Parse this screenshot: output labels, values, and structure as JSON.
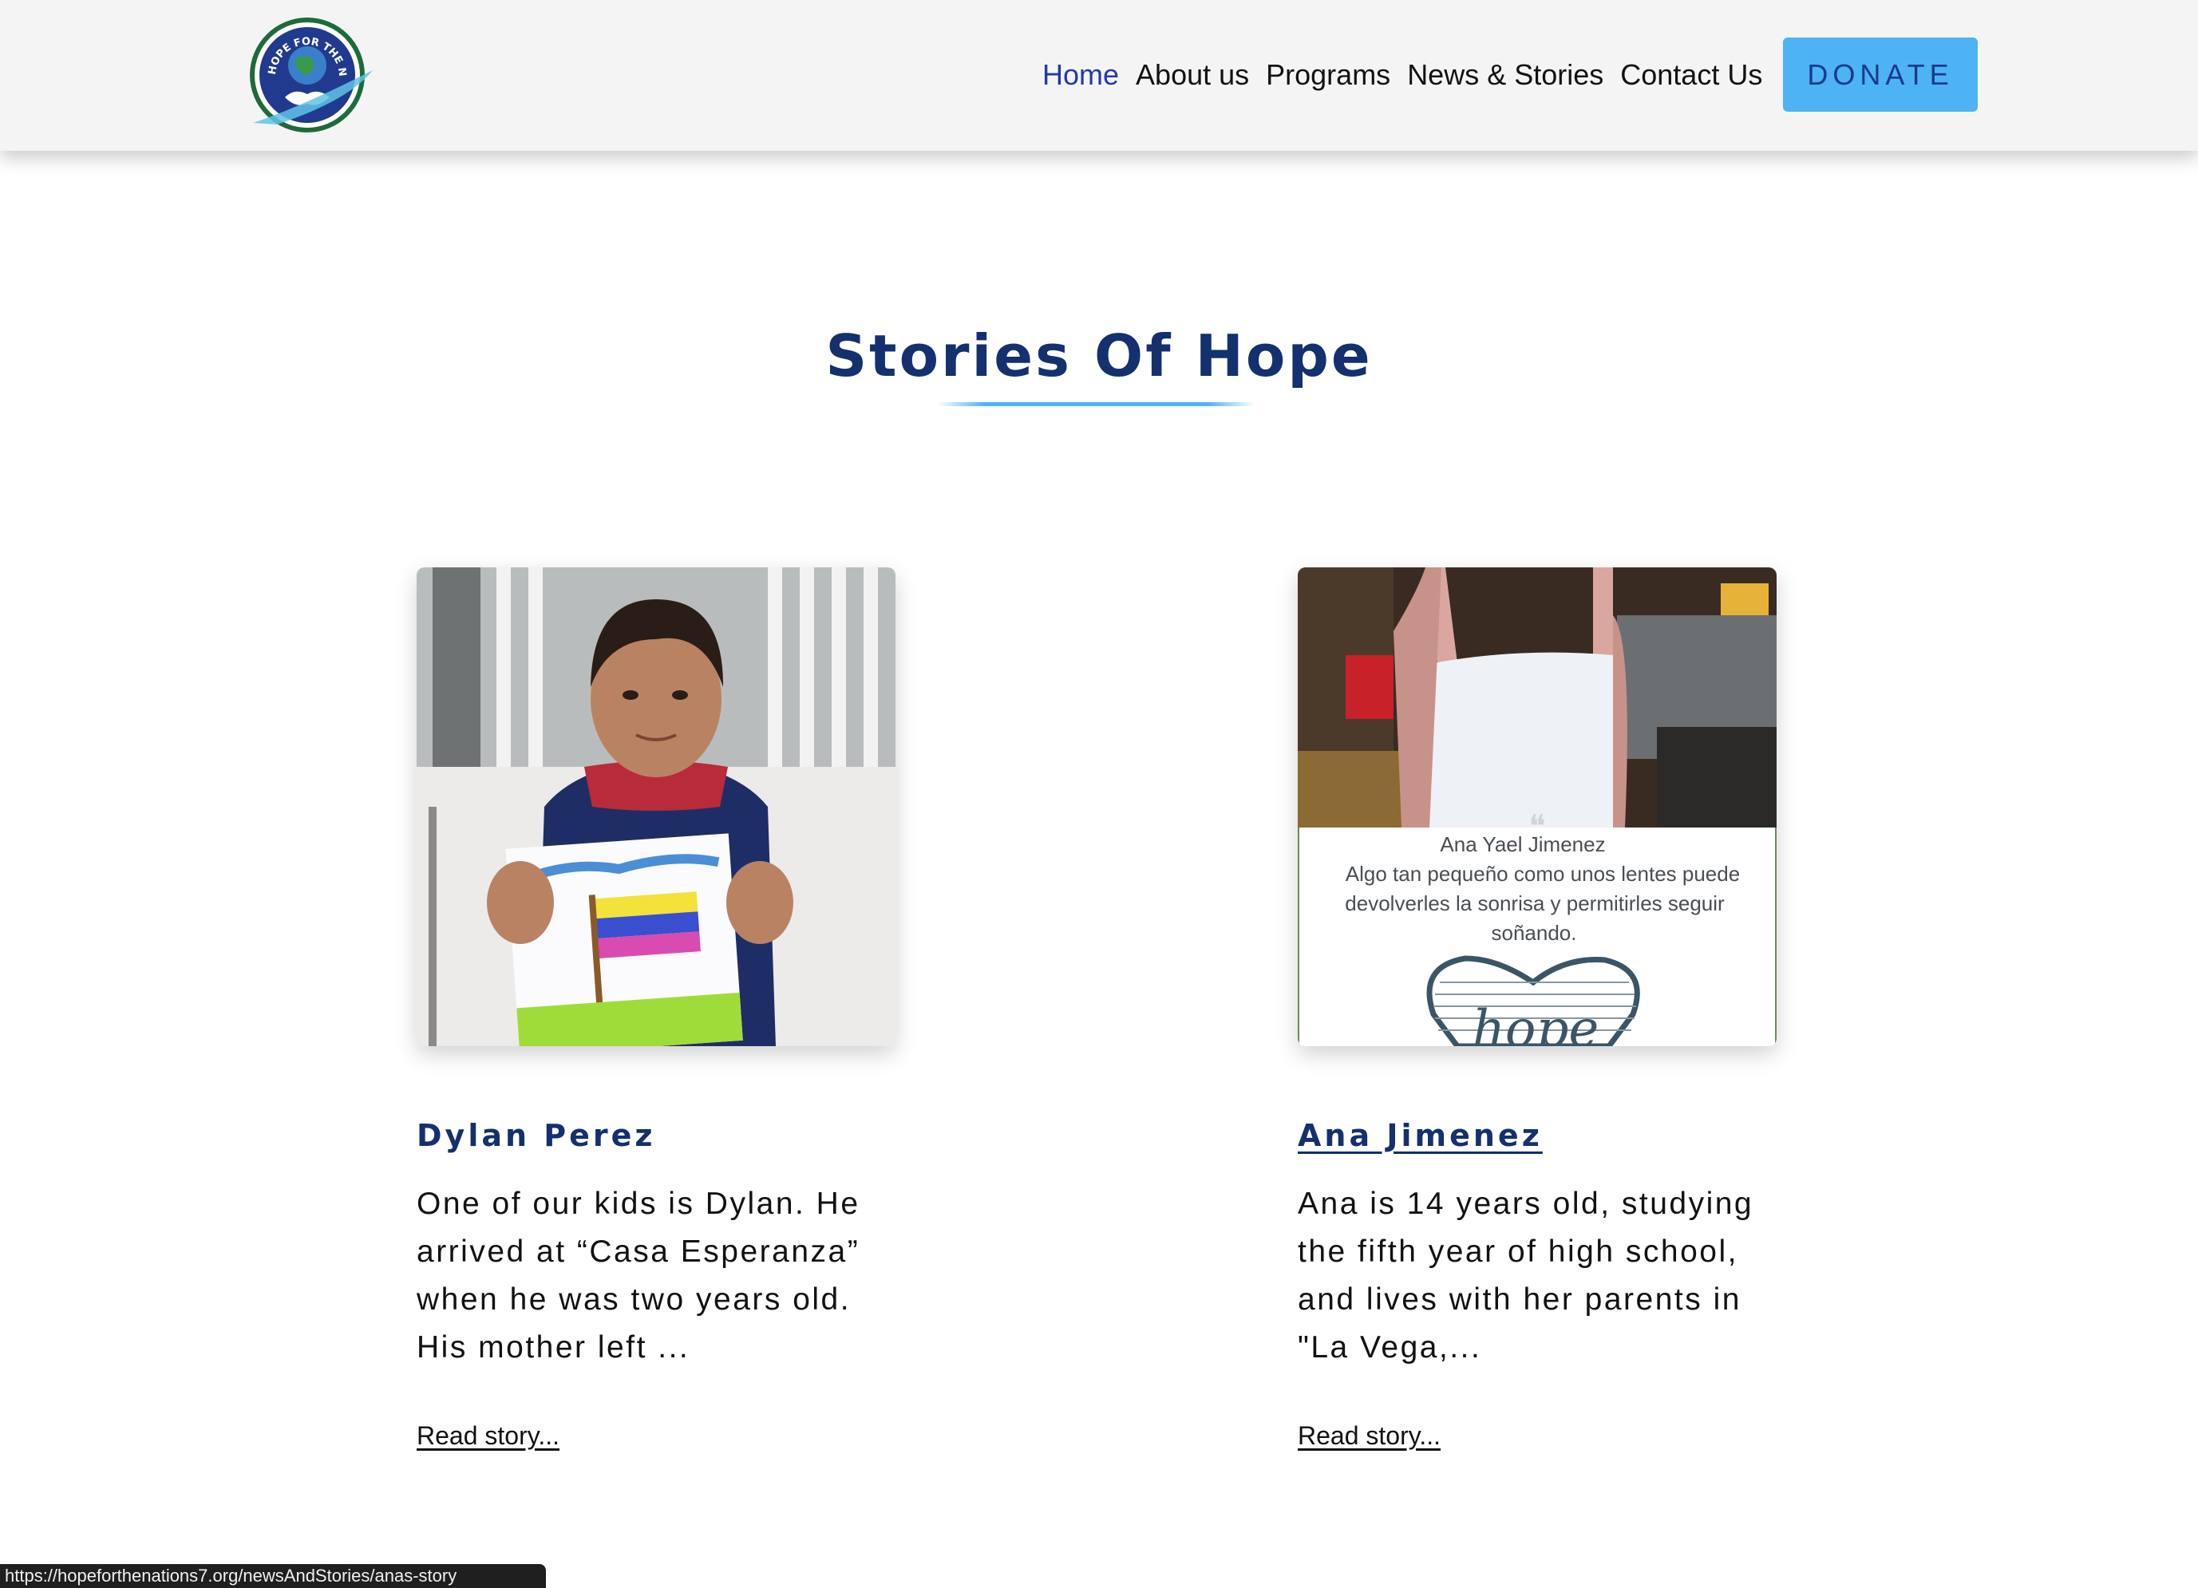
{
  "logo": {
    "text": "HOPE FOR THE NATIONS"
  },
  "nav": {
    "items": [
      {
        "label": "Home",
        "active": true
      },
      {
        "label": "About us",
        "active": false
      },
      {
        "label": "Programs",
        "active": false
      },
      {
        "label": "News & Stories",
        "active": false
      },
      {
        "label": "Contact Us",
        "active": false
      }
    ],
    "donate_label": "DONATE"
  },
  "section": {
    "title": "Stories Of Hope"
  },
  "stories": [
    {
      "name": "Dylan Perez",
      "excerpt": "One of our kids is Dylan. He arrived at “Casa Esperanza” when he was two years old. His mother left ...",
      "read_more": "Read story..."
    },
    {
      "name": "Ana Jimenez",
      "excerpt": "Ana is 14 years old, studying the fifth year of high school, and lives with her parents in \"La Vega,...",
      "read_more": "Read story...",
      "image_quote": {
        "author": "Ana Yael Jimenez",
        "line1": "Algo tan pequeño como unos lentes puede",
        "line2": "devolverles la sonrisa y permitirles seguir",
        "line3": "soñando.",
        "heart_word": "hope"
      }
    }
  ],
  "status_bar": {
    "url": "https://hopeforthenations7.org/newsAndStories/anas-story"
  },
  "colors": {
    "header_bg": "#f4f4f4",
    "nav_active": "#2237b3",
    "donate_bg": "#4db3f5",
    "title": "#15306f",
    "accent": "#4db3f5"
  }
}
